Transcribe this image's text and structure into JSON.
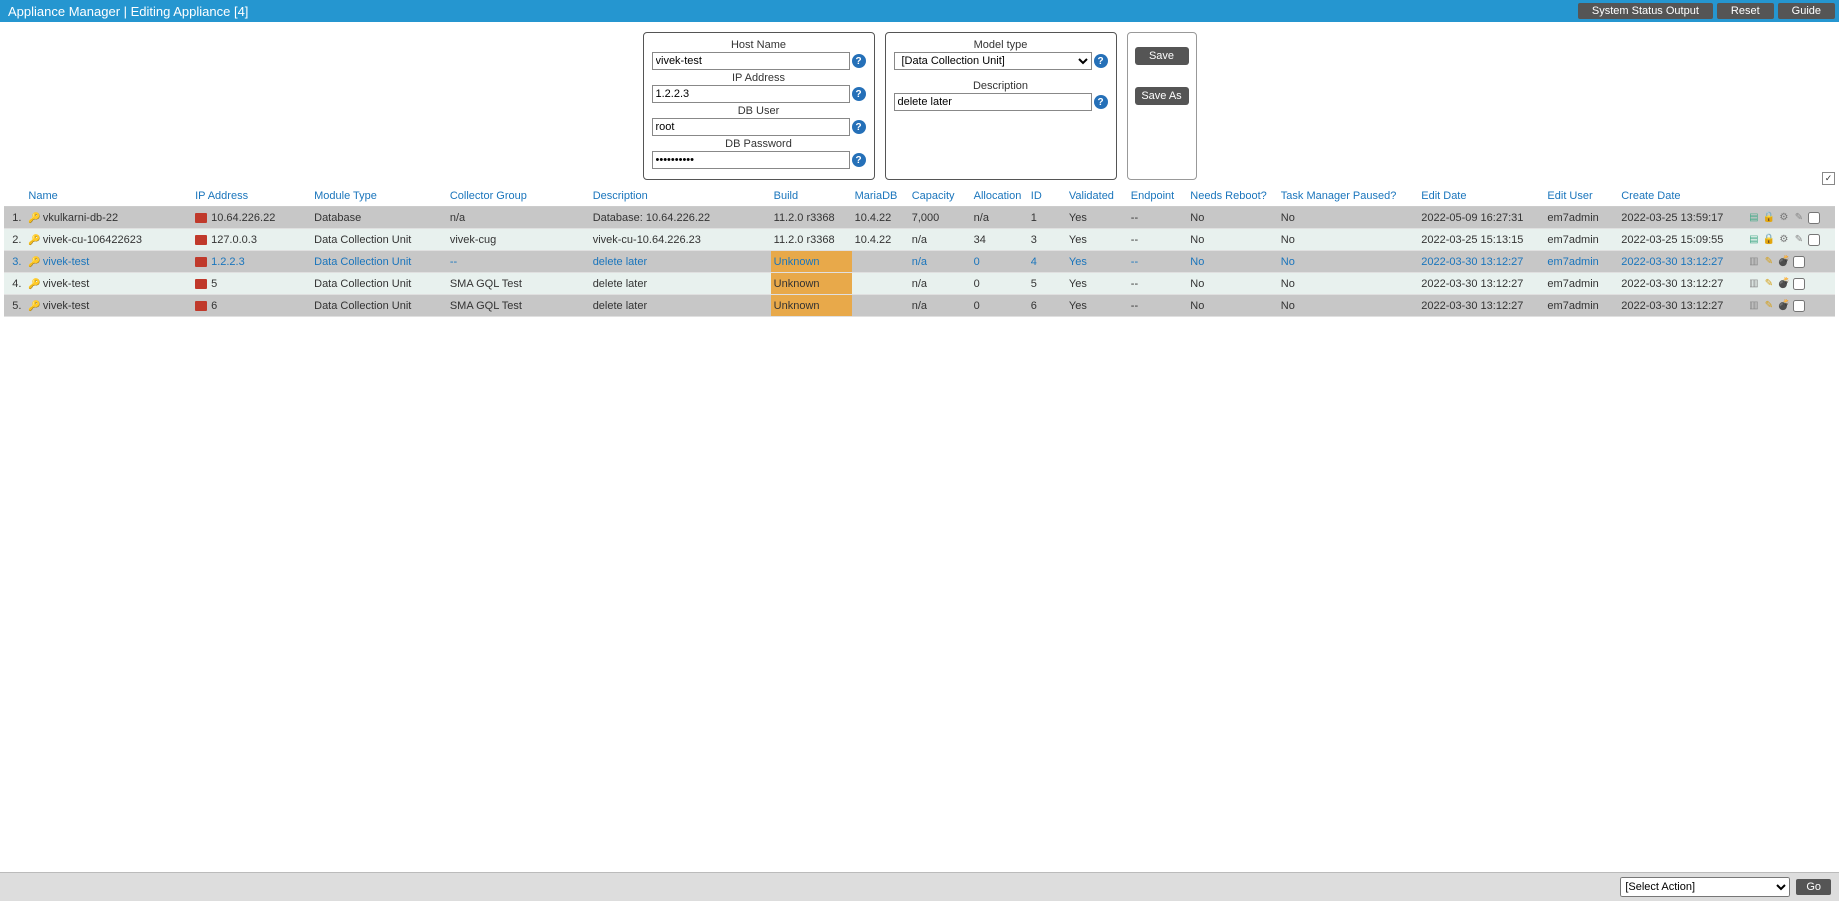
{
  "header": {
    "title": "Appliance Manager | Editing Appliance [4]",
    "buttons": {
      "status": "System Status Output",
      "reset": "Reset",
      "guide": "Guide"
    }
  },
  "form": {
    "host_label": "Host Name",
    "host_value": "vivek-test",
    "ip_label": "IP Address",
    "ip_value": "1.2.2.3",
    "dbuser_label": "DB User",
    "dbuser_value": "root",
    "dbpass_label": "DB Password",
    "dbpass_value": "••••••••••",
    "model_label": "Model type",
    "model_value": "[Data Collection Unit]",
    "desc_label": "Description",
    "desc_value": "delete later",
    "save": "Save",
    "saveas": "Save As"
  },
  "columns": {
    "name": "Name",
    "ip": "IP Address",
    "module": "Module Type",
    "collector": "Collector Group",
    "desc": "Description",
    "build": "Build",
    "mariadb": "MariaDB",
    "capacity": "Capacity",
    "allocation": "Allocation",
    "id": "ID",
    "validated": "Validated",
    "endpoint": "Endpoint",
    "reboot": "Needs Reboot?",
    "paused": "Task Manager Paused?",
    "editdate": "Edit Date",
    "edituser": "Edit User",
    "createdate": "Create Date"
  },
  "rows": [
    {
      "n": "1.",
      "name": "vkulkarni-db-22",
      "ip": "10.64.226.22",
      "module": "Database",
      "collector": "n/a",
      "desc": "Database: 10.64.226.22",
      "build": "11.2.0 r3368",
      "mariadb": "10.4.22",
      "capacity": "7,000",
      "allocation": "n/a",
      "id": "1",
      "validated": "Yes",
      "endpoint": "--",
      "reboot": "No",
      "paused": "No",
      "editdate": "2022-05-09 16:27:31",
      "edituser": "em7admin",
      "createdate": "2022-03-25 13:59:17",
      "selected": false,
      "build_unknown": false,
      "icons": "full"
    },
    {
      "n": "2.",
      "name": "vivek-cu-106422623",
      "ip": "127.0.0.3",
      "module": "Data Collection Unit",
      "collector": "vivek-cug",
      "desc": "vivek-cu-10.64.226.23",
      "build": "11.2.0 r3368",
      "mariadb": "10.4.22",
      "capacity": "n/a",
      "allocation": "34",
      "id": "3",
      "validated": "Yes",
      "endpoint": "--",
      "reboot": "No",
      "paused": "No",
      "editdate": "2022-03-25 15:13:15",
      "edituser": "em7admin",
      "createdate": "2022-03-25 15:09:55",
      "selected": false,
      "build_unknown": false,
      "icons": "full"
    },
    {
      "n": "3.",
      "name": "vivek-test",
      "ip": "1.2.2.3",
      "module": "Data Collection Unit",
      "collector": "--",
      "desc": "delete later",
      "build": "Unknown",
      "mariadb": "",
      "capacity": "n/a",
      "allocation": "0",
      "id": "4",
      "validated": "Yes",
      "endpoint": "--",
      "reboot": "No",
      "paused": "No",
      "editdate": "2022-03-30 13:12:27",
      "edituser": "em7admin",
      "createdate": "2022-03-30 13:12:27",
      "selected": true,
      "build_unknown": true,
      "icons": "min"
    },
    {
      "n": "4.",
      "name": "vivek-test",
      "ip": "5",
      "module": "Data Collection Unit",
      "collector": "SMA GQL Test",
      "desc": "delete later",
      "build": "Unknown",
      "mariadb": "",
      "capacity": "n/a",
      "allocation": "0",
      "id": "5",
      "validated": "Yes",
      "endpoint": "--",
      "reboot": "No",
      "paused": "No",
      "editdate": "2022-03-30 13:12:27",
      "edituser": "em7admin",
      "createdate": "2022-03-30 13:12:27",
      "selected": false,
      "build_unknown": true,
      "icons": "min"
    },
    {
      "n": "5.",
      "name": "vivek-test",
      "ip": "6",
      "module": "Data Collection Unit",
      "collector": "SMA GQL Test",
      "desc": "delete later",
      "build": "Unknown",
      "mariadb": "",
      "capacity": "n/a",
      "allocation": "0",
      "id": "6",
      "validated": "Yes",
      "endpoint": "--",
      "reboot": "No",
      "paused": "No",
      "editdate": "2022-03-30 13:12:27",
      "edituser": "em7admin",
      "createdate": "2022-03-30 13:12:27",
      "selected": false,
      "build_unknown": true,
      "icons": "min"
    }
  ],
  "footer": {
    "action_placeholder": "[Select Action]",
    "go": "Go"
  }
}
